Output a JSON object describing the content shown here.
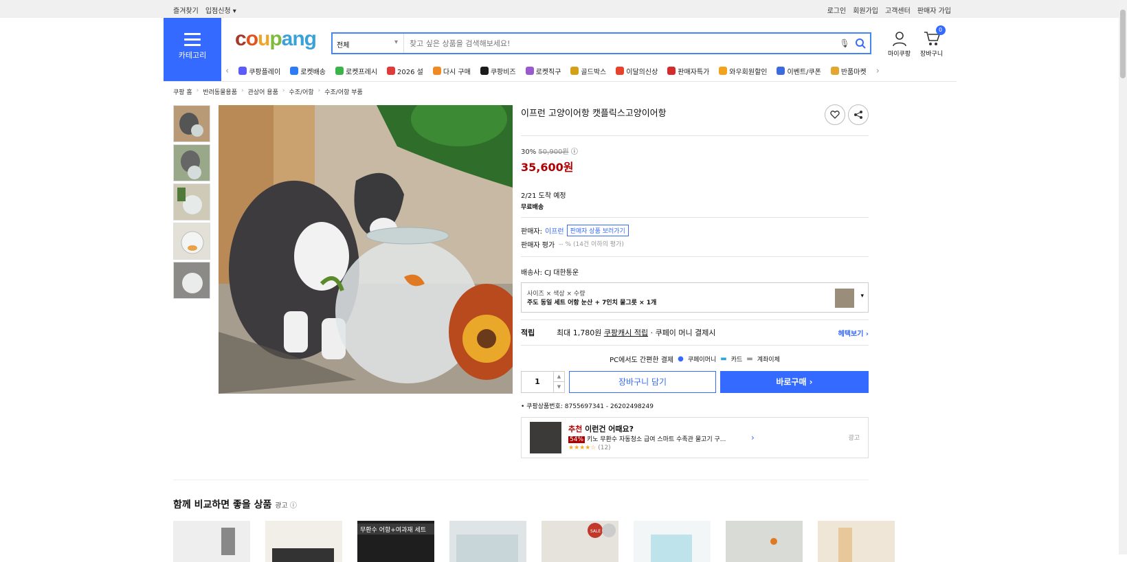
{
  "topbar": {
    "left": [
      "즐겨찾기",
      "입점신청 ▾"
    ],
    "right": [
      "로그인",
      "회원가입",
      "고객센터",
      "판매자 가입"
    ]
  },
  "header": {
    "category_label": "카테고리",
    "logo": "coupang",
    "search_scope": "전체",
    "search_placeholder": "찾고 싶은 상품을 검색해보세요!",
    "mycoupang": "마이쿠팡",
    "cart": "장바구니",
    "cart_count": "0"
  },
  "nav": [
    {
      "label": "쿠팡플레이",
      "color": "#5b5bff"
    },
    {
      "label": "로켓배송",
      "color": "#2d7cf6"
    },
    {
      "label": "로켓프레시",
      "color": "#3bb54a"
    },
    {
      "label": "2026 설",
      "color": "#e03a3a"
    },
    {
      "label": "다시 구매",
      "color": "#f08a24"
    },
    {
      "label": "쿠팡비즈",
      "color": "#1b1b1b"
    },
    {
      "label": "로켓직구",
      "color": "#9b59d0"
    },
    {
      "label": "골드박스",
      "color": "#d4a017"
    },
    {
      "label": "이달의신상",
      "color": "#e8412c"
    },
    {
      "label": "판매자특가",
      "color": "#d62b2b"
    },
    {
      "label": "와우회원할인",
      "color": "#f3a21c"
    },
    {
      "label": "이벤트/쿠폰",
      "color": "#3b6bdc"
    },
    {
      "label": "반품마켓",
      "color": "#e3a72f"
    }
  ],
  "breadcrumb": [
    "쿠팡 홈",
    "반려동물용품",
    "관상어 용품",
    "수조/어항",
    "수조/어항 부품"
  ],
  "product": {
    "title": "이프런 고양이어항 캣플릭스고양이어항",
    "discount": "30%",
    "orig_price": "50,900원",
    "sale_price": "35,600원",
    "delivery_date": "2/21 도착 예정",
    "shipping": "무료배송",
    "seller_label": "판매자:",
    "seller": "이프런",
    "seller_link": "판매자 상품 보러가기",
    "seller_rating_label": "판매자 평가",
    "seller_rating": "-- % (14건 이하의 평가)",
    "carrier": "배송사:  CJ 대한통운",
    "option_head": "사이즈 × 색상 × 수량",
    "option_value": "주도 동일 세트 어항 눈산 + 7인치 물그릇 × 1개",
    "reward_label": "적립",
    "reward_text": "최대 1,780원",
    "reward_link": "쿠팡캐시 적립",
    "reward_extra": "· 쿠페이 머니 결제시",
    "benefit": "헤택보기 ›",
    "pay_title": "PC에서도 간편한 결제",
    "pay1": "쿠페이머니",
    "pay2": "카드",
    "pay3": "계좌이체",
    "qty": "1",
    "cart_btn": "장바구니 담기",
    "buy_btn": "바로구매 ›",
    "product_no": "쿠팡상품번호: 8755697341 - 26202498249"
  },
  "recommend": {
    "tag": "추천",
    "title": "이런건 어때요?",
    "badge": "54%",
    "name": "키노 무환수 자동청소 급여 스마트 수족관 물고기 구...",
    "reviews": "(12)",
    "ad": "광고"
  },
  "compare": {
    "title": "함께 비교하면 좋을 상품",
    "ad": "광고 ⓘ",
    "p3_label": "무환수 어항+여과재 세트",
    "sale": "SALE 50%"
  }
}
